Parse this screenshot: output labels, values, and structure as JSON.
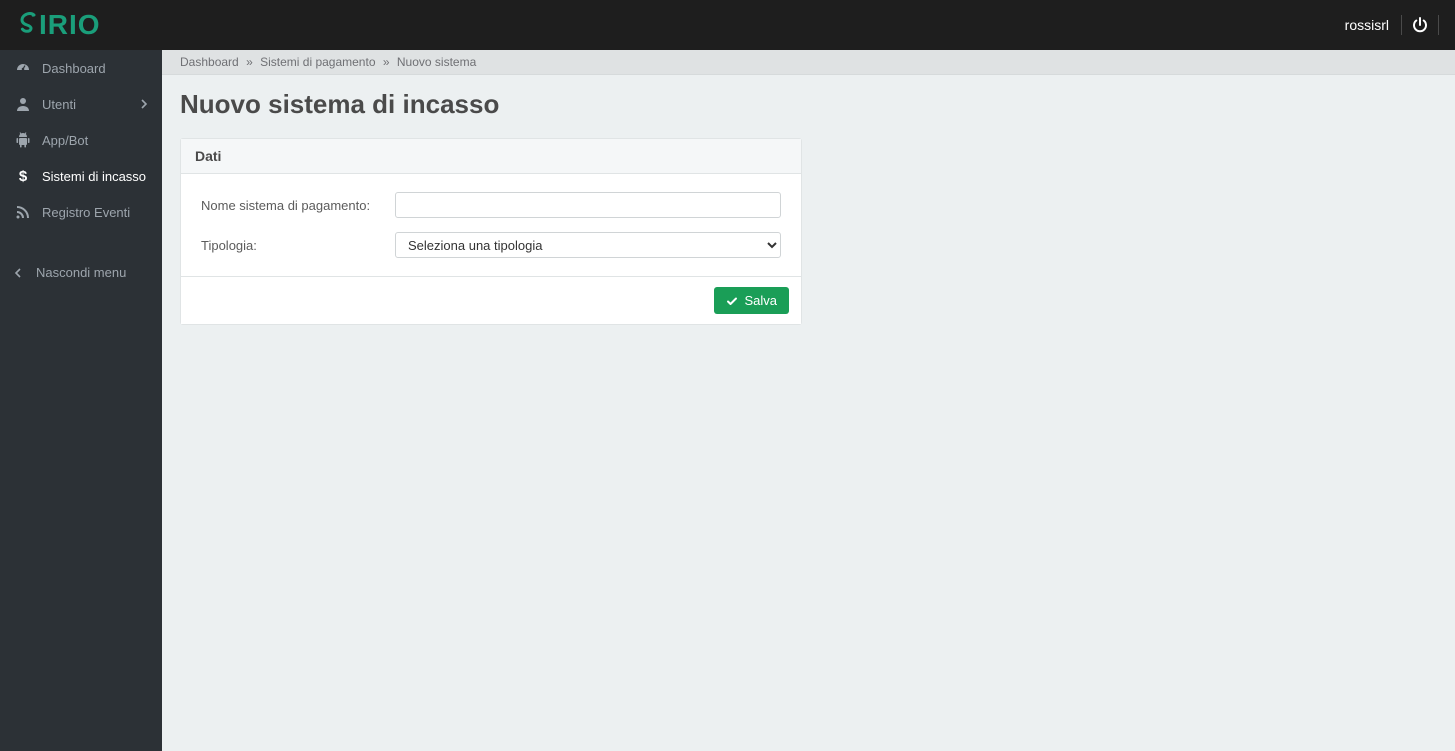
{
  "brand": "SIRIO",
  "header": {
    "username": "rossisrl"
  },
  "sidebar": {
    "items": [
      {
        "label": "Dashboard",
        "icon": "dashboard-icon",
        "expandable": false,
        "active": false
      },
      {
        "label": "Utenti",
        "icon": "user-icon",
        "expandable": true,
        "active": false
      },
      {
        "label": "App/Bot",
        "icon": "android-icon",
        "expandable": false,
        "active": false
      },
      {
        "label": "Sistemi di incasso",
        "icon": "dollar-icon",
        "expandable": false,
        "active": true
      },
      {
        "label": "Registro Eventi",
        "icon": "rss-icon",
        "expandable": false,
        "active": false
      }
    ],
    "collapse_label": "Nascondi menu"
  },
  "breadcrumbs": {
    "items": [
      {
        "label": "Dashboard",
        "link": true
      },
      {
        "label": "Sistemi di pagamento",
        "link": true
      },
      {
        "label": "Nuovo sistema",
        "link": false
      }
    ],
    "separator": "»"
  },
  "page": {
    "title": "Nuovo sistema di incasso"
  },
  "panel": {
    "header": "Dati",
    "fields": {
      "name": {
        "label": "Nome sistema di pagamento:",
        "value": ""
      },
      "type": {
        "label": "Tipologia:",
        "placeholder_option": "Seleziona una tipologia"
      }
    },
    "save_label": "Salva"
  }
}
